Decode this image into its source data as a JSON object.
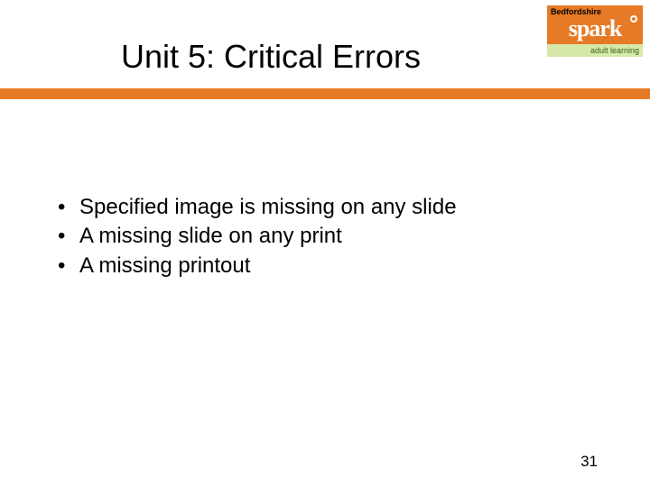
{
  "title": "Unit 5: Critical Errors",
  "logo": {
    "top": "Bedfordshire",
    "mid": "spark",
    "bot": "adult learning"
  },
  "bullets": [
    "Specified image is missing on any slide",
    "A missing slide on any print",
    "A missing printout"
  ],
  "page_number": "31",
  "colors": {
    "accent": "#e77a26"
  }
}
